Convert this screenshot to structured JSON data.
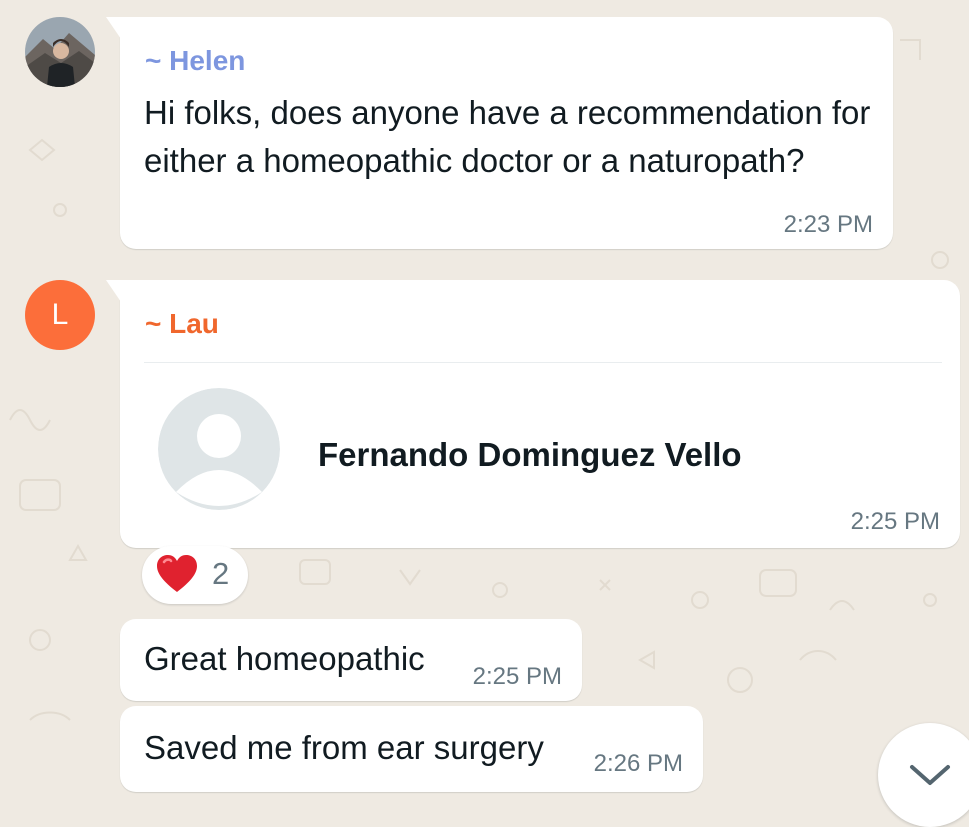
{
  "messages": [
    {
      "sender": "~ Helen",
      "text": "Hi folks, does anyone have a recommendation for either a homeopathic doctor or a naturopath?",
      "time": "2:23 PM",
      "avatar_icon": "profile-photo",
      "sender_color": "#7d96df"
    },
    {
      "sender": "~ Lau",
      "avatar_initial": "L",
      "sender_color": "#f0672d",
      "avatar_color": "#fc6e3a",
      "contact_card": {
        "name": "Fernando Dominguez Vello",
        "avatar_icon": "default-contact-icon"
      },
      "time": "2:25 PM",
      "reaction": {
        "emoji": "heart-emoji-icon",
        "count": "2"
      }
    },
    {
      "text": "Great homeopathic",
      "time": "2:25 PM"
    },
    {
      "text": "Saved me from ear surgery",
      "time": "2:26 PM"
    }
  ],
  "scroll_button": {
    "icon": "chevron-down-icon"
  }
}
